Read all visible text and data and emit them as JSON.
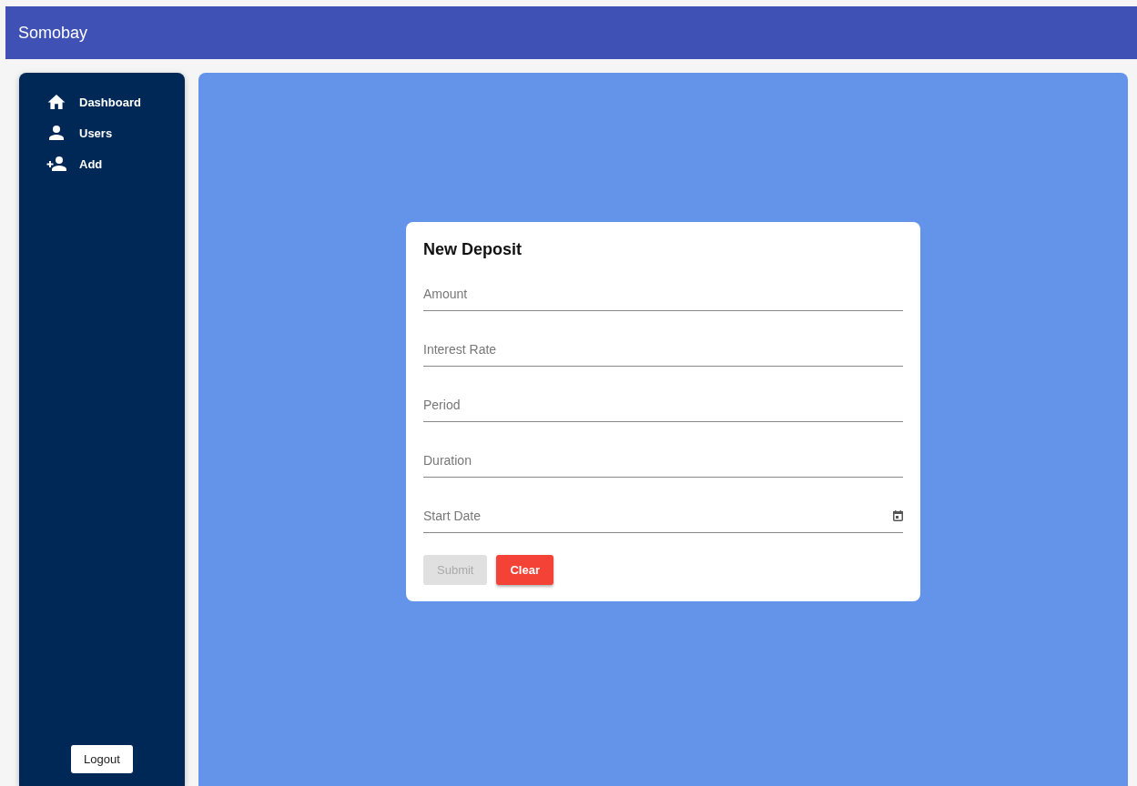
{
  "app_bar": {
    "title": "Somobay"
  },
  "sidebar": {
    "items": [
      {
        "label": "Dashboard",
        "kind": "home"
      },
      {
        "label": "Users",
        "kind": "user"
      },
      {
        "label": "Add",
        "kind": "add-user"
      }
    ],
    "logout": "Logout"
  },
  "form": {
    "title": "New Deposit",
    "fields": [
      {
        "placeholder": "Amount",
        "kind": "text"
      },
      {
        "placeholder": "Interest Rate",
        "kind": "text"
      },
      {
        "placeholder": "Period",
        "kind": "text"
      },
      {
        "placeholder": "Duration",
        "kind": "text"
      },
      {
        "placeholder": "Start Date",
        "kind": "date"
      }
    ],
    "buttons": [
      {
        "label": "Submit",
        "kind": "primary",
        "disabled": true
      },
      {
        "label": "Clear",
        "kind": "danger",
        "disabled": false
      }
    ]
  }
}
